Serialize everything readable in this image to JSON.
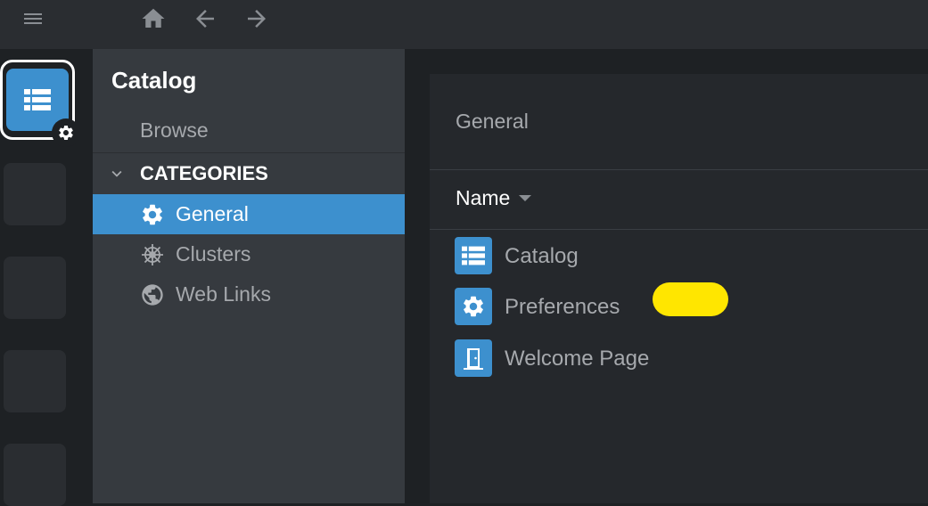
{
  "topbar": {
    "icons": [
      "menu-icon",
      "home-icon",
      "back-arrow-icon",
      "forward-arrow-icon"
    ]
  },
  "hotbar": {
    "active_icon": "catalog-list-icon",
    "badge_icon": "gear-icon",
    "empty_slots": 4
  },
  "sidebar": {
    "title": "Catalog",
    "browse": "Browse",
    "categories_label": "CATEGORIES",
    "items": [
      {
        "label": "General",
        "icon": "gear-icon",
        "active": true
      },
      {
        "label": "Clusters",
        "icon": "helm-icon",
        "active": false
      },
      {
        "label": "Web Links",
        "icon": "globe-icon",
        "active": false
      }
    ]
  },
  "main": {
    "title": "General",
    "column_header": "Name",
    "rows": [
      {
        "label": "Catalog",
        "icon": "catalog-list-icon"
      },
      {
        "label": "Preferences",
        "icon": "gear-icon"
      },
      {
        "label": "Welcome Page",
        "icon": "door-icon"
      }
    ]
  },
  "colors": {
    "accent": "#3d90ce",
    "highlight": "#ffe600",
    "sidebar_bg": "#363a3f",
    "main_bg": "#25282c",
    "topbar_bg": "#2a2d31"
  }
}
